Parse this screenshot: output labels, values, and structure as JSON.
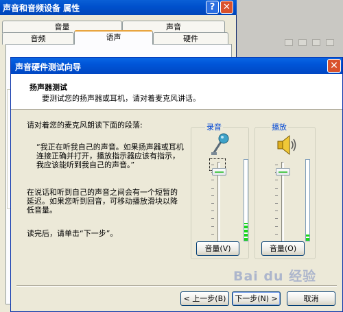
{
  "props_window": {
    "title": "声音和音频设备 属性",
    "help_glyph": "?",
    "close_glyph": "✕",
    "tabs_row1": [
      "音量",
      "声音"
    ],
    "tabs_row2": [
      "音频",
      "语声",
      "硬件"
    ],
    "selected_tab": "语声"
  },
  "wizard": {
    "title": "声音硬件测试向导",
    "close_glyph": "✕",
    "header_title": "扬声器测试",
    "header_subtitle": "要测试您的扬声器或耳机，请对着麦克风讲话。",
    "instruction": "请对着您的麦克风朗读下面的段落:",
    "quote": "“我正在听我自己的声音。如果扬声器或耳机连接正确并打开，播放指示器应该有指示，我应该能听到我自己的声音。”",
    "latency_note": "在说话和听到自己的声音之间会有一个短暂的延迟。如果您听到回音，可移动播放滑块以降低音量。",
    "finish_note": "读完后，请单击“下一步”。",
    "record_group": {
      "label": "录音",
      "icon": "microphone-icon",
      "slider_level": 0.92,
      "meter_level": 0.22,
      "button_label": "音量(V)"
    },
    "play_group": {
      "label": "播放",
      "icon": "speaker-icon",
      "slider_level": 0.92,
      "meter_level": 0.08,
      "button_label": "音量(O)"
    },
    "buttons": {
      "back": "< 上一步(B)",
      "next": "下一步(N) >",
      "cancel": "取消"
    }
  },
  "watermark": "Bai du 经验",
  "colors": {
    "titlebar": "#0055d8",
    "group_label": "#0046d5",
    "meter": "#18d818",
    "close": "#d9522c"
  }
}
